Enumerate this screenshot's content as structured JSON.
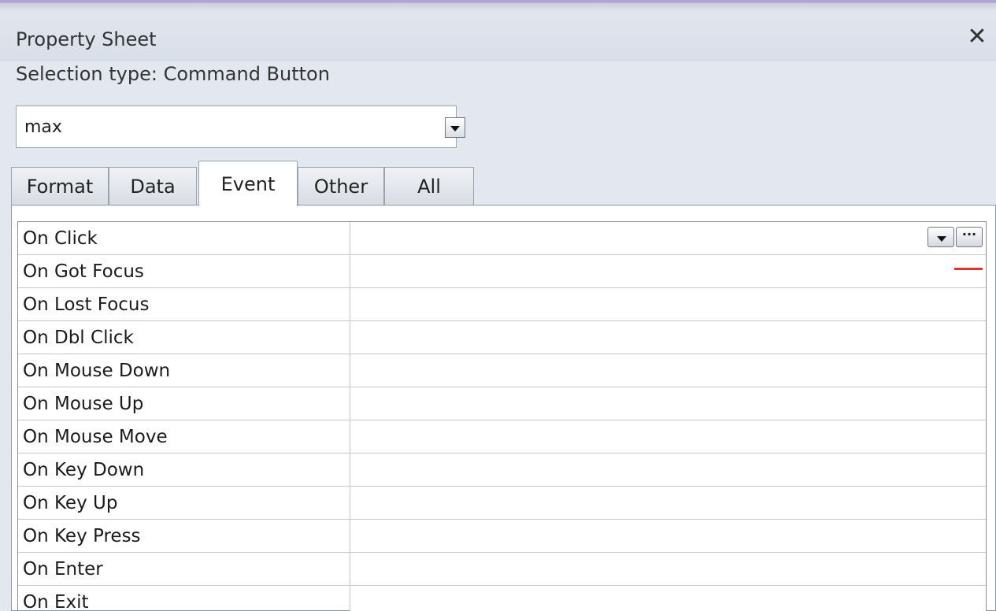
{
  "window": {
    "title": "Property Sheet"
  },
  "selection": {
    "label": "Selection type:",
    "type": "Command Button"
  },
  "object_select": {
    "value": "max"
  },
  "tabs": [
    {
      "label": "Format"
    },
    {
      "label": "Data"
    },
    {
      "label": "Event",
      "active": true
    },
    {
      "label": "Other"
    },
    {
      "label": "All"
    }
  ],
  "events": [
    {
      "label": "On Click",
      "value": ""
    },
    {
      "label": "On Got Focus",
      "value": ""
    },
    {
      "label": "On Lost Focus",
      "value": ""
    },
    {
      "label": "On Dbl Click",
      "value": ""
    },
    {
      "label": "On Mouse Down",
      "value": ""
    },
    {
      "label": "On Mouse Up",
      "value": ""
    },
    {
      "label": "On Mouse Move",
      "value": ""
    },
    {
      "label": "On Key Down",
      "value": ""
    },
    {
      "label": "On Key Up",
      "value": ""
    },
    {
      "label": "On Key Press",
      "value": ""
    },
    {
      "label": "On Enter",
      "value": ""
    },
    {
      "label": "On Exit",
      "value": ""
    }
  ],
  "builder_button": {
    "label": "···"
  },
  "icons": {
    "close": "close-icon",
    "dropdown": "chevron-down-icon"
  },
  "colors": {
    "annotation_mark": "#dd3333"
  }
}
